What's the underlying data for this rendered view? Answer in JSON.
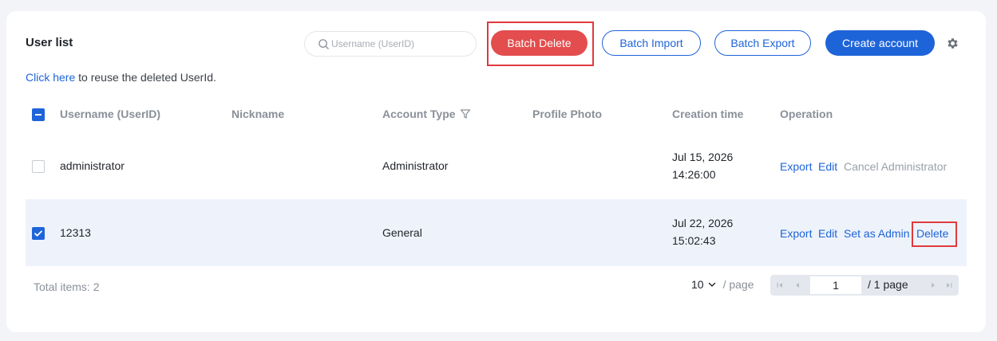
{
  "header": {
    "title": "User list",
    "search_placeholder": "Username (UserID)",
    "batch_delete": "Batch Delete",
    "batch_import": "Batch Import",
    "batch_export": "Batch Export",
    "create_account": "Create account"
  },
  "notice": {
    "link": "Click here",
    "text": " to reuse the deleted UserId."
  },
  "table": {
    "columns": [
      "Username (UserID)",
      "Nickname",
      "Account Type",
      "Profile Photo",
      "Creation time",
      "Operation"
    ],
    "rows": [
      {
        "checked": false,
        "username": "administrator",
        "nickname": "",
        "account_type": "Administrator",
        "date": "Jul 15, 2026",
        "time": "14:26:00",
        "ops": [
          "Export",
          "Edit",
          "Cancel Administrator"
        ]
      },
      {
        "checked": true,
        "username": "12313",
        "nickname": "",
        "account_type": "General",
        "date": "Jul 22, 2026",
        "time": "15:02:43",
        "ops": [
          "Export",
          "Edit",
          "Set as Admin",
          "Delete"
        ]
      }
    ]
  },
  "footer": {
    "total_label": "Total items:",
    "total_value": "2",
    "page_size": "10",
    "page_size_unit": "/ page",
    "current_page": "1",
    "total_pages": "/ 1 page"
  },
  "colors": {
    "primary": "#1e64d9",
    "danger": "#e34d4d",
    "highlight_box": "#e0393e",
    "selected_row": "#eef3fb"
  }
}
